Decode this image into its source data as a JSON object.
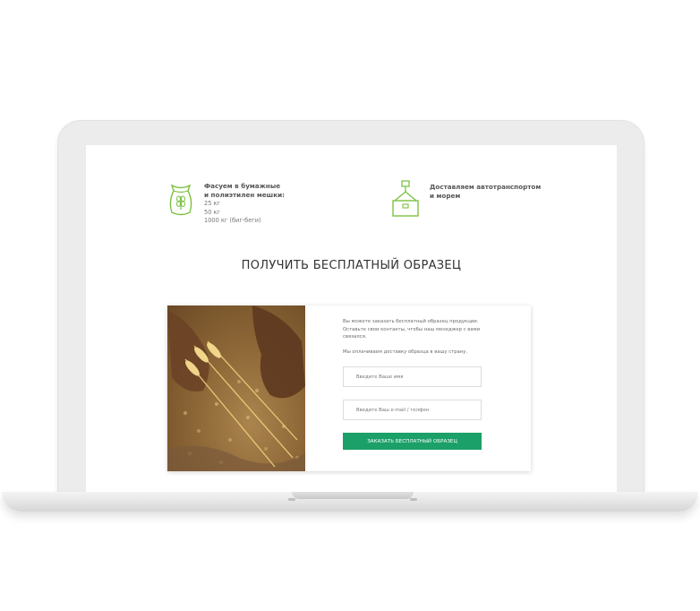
{
  "features": [
    {
      "icon": "grain-sack-icon",
      "title_line1": "Фасуем в бумажные",
      "title_line2": "и полиэтилен мешки:",
      "details": [
        "25 кг",
        "50 кг",
        "1000 кг (биг-беги)"
      ]
    },
    {
      "icon": "crane-container-icon",
      "title_line1": "Доставляем автотранспортом",
      "title_line2": "и морем"
    }
  ],
  "sample": {
    "heading": "ПОЛУЧИТЬ БЕСПЛАТНЫЙ ОБРАЗЕЦ",
    "intro_line1": "Вы можете заказать бесплатный образец продукции.",
    "intro_line2": "Оставьте свои контакты, чтобы наш менеджер с вами",
    "intro_line3": "связался.",
    "delivery_note": "Мы оплачиваем доставку образца в вашу страну.",
    "name_placeholder": "Введите Ваше имя",
    "contact_placeholder": "Введите Ваш e-mail / телфон",
    "submit_label": "ЗАКАЗАТЬ БЕСПЛАТНЫЙ ОБРАЗЕЦ"
  },
  "colors": {
    "accent_green": "#1aa068",
    "icon_green": "#7cc142"
  }
}
